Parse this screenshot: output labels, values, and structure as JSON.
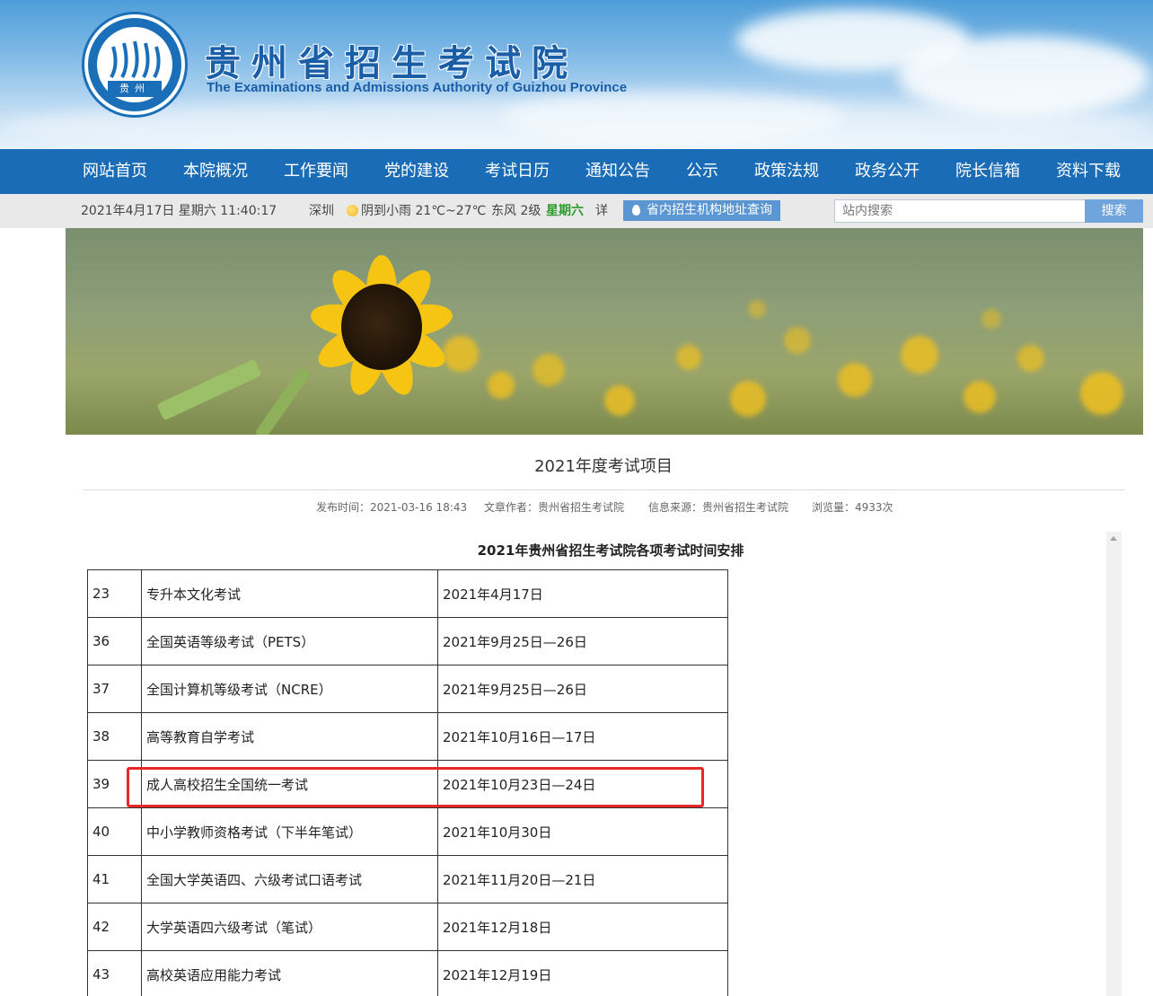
{
  "header": {
    "logo_text": "贵州",
    "title": "贵州省招生考试院",
    "subtitle": "The Examinations and Admissions Authority of Guizhou Province"
  },
  "nav": {
    "items": [
      "网站首页",
      "本院概况",
      "工作要闻",
      "党的建设",
      "考试日历",
      "通知公告",
      "公示",
      "政策法规",
      "政务公开",
      "院长信箱",
      "资料下载"
    ]
  },
  "infobar": {
    "datetime": "2021年4月17日 星期六 11:40:17",
    "city": "深圳",
    "weather": "阴到小雨 21℃~27℃",
    "wind": "东风 2级",
    "weekday": "星期六",
    "detail_link": "详",
    "address_button": "省内招生机构地址查询",
    "search_placeholder": "站内搜索",
    "search_button": "搜索"
  },
  "article": {
    "title": "2021年度考试项目",
    "meta": {
      "published": "发布时间：2021-03-16 18:43",
      "author": "文章作者：贵州省招生考试院",
      "source": "信息来源：贵州省招生考试院",
      "views": "浏览量：4933次"
    },
    "table_caption": "2021年贵州省招生考试院各项考试时间安排",
    "rows": [
      {
        "no": "23",
        "name": "专升本文化考试",
        "date": "2021年4月17日"
      },
      {
        "no": "36",
        "name": "全国英语等级考试（PETS）",
        "date": "2021年9月25日—26日"
      },
      {
        "no": "37",
        "name": "全国计算机等级考试（NCRE）",
        "date": "2021年9月25日—26日"
      },
      {
        "no": "38",
        "name": "高等教育自学考试",
        "date": "2021年10月16日—17日"
      },
      {
        "no": "39",
        "name": "成人高校招生全国统一考试",
        "date": "2021年10月23日—24日"
      },
      {
        "no": "40",
        "name": "中小学教师资格考试（下半年笔试）",
        "date": "2021年10月30日"
      },
      {
        "no": "41",
        "name": "全国大学英语四、六级考试口语考试",
        "date": "2021年11月20日—21日"
      },
      {
        "no": "42",
        "name": "大学英语四六级考试（笔试）",
        "date": "2021年12月18日"
      },
      {
        "no": "43",
        "name": "高校英语应用能力考试",
        "date": "2021年12月19日"
      }
    ]
  },
  "colors": {
    "nav_bg": "#1a6cb6",
    "highlight": "#e8272a",
    "weekday": "#2e9b2e"
  }
}
